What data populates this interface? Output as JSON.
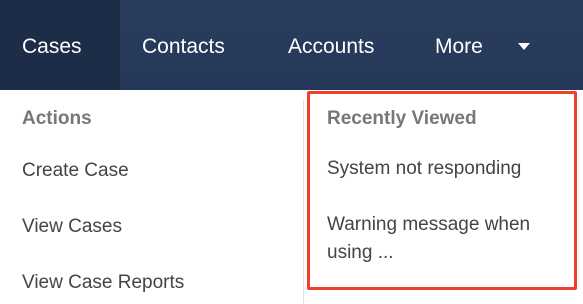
{
  "navbar": {
    "tabs": [
      {
        "label": "Cases"
      },
      {
        "label": "Contacts"
      },
      {
        "label": "Accounts"
      },
      {
        "label": "More"
      }
    ]
  },
  "actions": {
    "heading": "Actions",
    "items": [
      {
        "label": "Create Case"
      },
      {
        "label": "View Cases"
      },
      {
        "label": "View Case Reports"
      }
    ]
  },
  "recently_viewed": {
    "heading": "Recently Viewed",
    "items": [
      {
        "label": "System not responding"
      },
      {
        "label": "Warning message when using ..."
      }
    ]
  },
  "colors": {
    "navbar_bg": "#26385a",
    "active_tab_bg": "#1d2c47",
    "highlight_border": "#f0402a"
  }
}
